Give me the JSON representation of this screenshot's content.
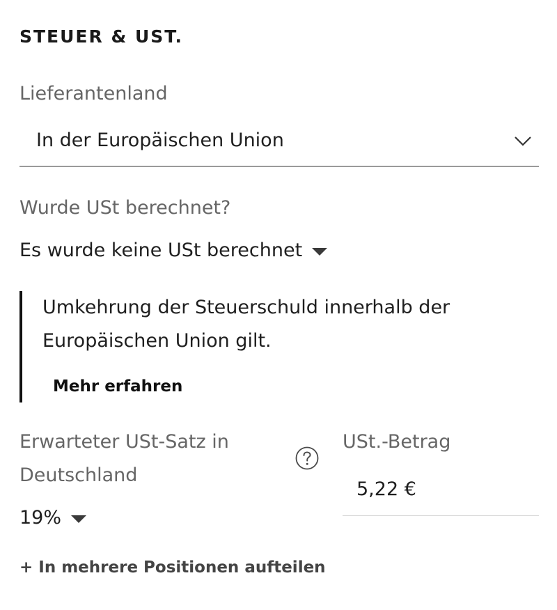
{
  "section": {
    "title": "STEUER & UST."
  },
  "supplier_country": {
    "label": "Lieferantenland",
    "value": "In der Europäischen Union",
    "icon": "chevron-down-icon"
  },
  "vat_charged": {
    "label": "Wurde USt berechnet?",
    "value": "Es wurde keine USt berechnet",
    "icon": "caret-down-icon"
  },
  "info": {
    "text": "Umkehrung der Steuerschuld innerhalb der Europäischen Union gilt.",
    "link": "Mehr erfahren"
  },
  "expected_rate": {
    "label": "Erwarteter USt-Satz in Deutschland",
    "value": "19%",
    "help_icon": "question-circle-icon"
  },
  "vat_amount": {
    "label": "USt.-Betrag",
    "value": "5,22 €"
  },
  "actions": {
    "split": "+ In mehrere Positionen aufteilen"
  },
  "colors": {
    "text": "#1f1f1f",
    "muted": "#666666",
    "border": "#9a9a9a",
    "info_bar": "#111111"
  }
}
